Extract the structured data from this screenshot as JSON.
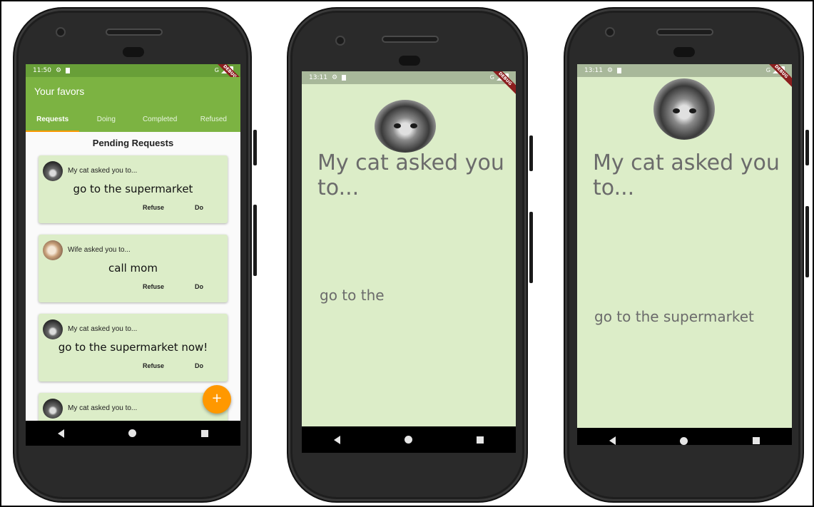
{
  "phones": [
    {
      "status": {
        "time": "11:50",
        "network": "G"
      },
      "debug_banner": "DEBUG",
      "appbar": {
        "title": "Your favors"
      },
      "tabs": [
        {
          "label": "Requests"
        },
        {
          "label": "Doing"
        },
        {
          "label": "Completed"
        },
        {
          "label": "Refused"
        }
      ],
      "section_title": "Pending Requests",
      "cards": [
        {
          "from": "My cat asked you to...",
          "what": "go to the supermarket",
          "refuse": "Refuse",
          "do": "Do"
        },
        {
          "from": "Wife asked you to...",
          "what": "call mom",
          "refuse": "Refuse",
          "do": "Do"
        },
        {
          "from": "My cat asked you to...",
          "what": "go to the supermarket now!",
          "refuse": "Refuse",
          "do": "Do"
        },
        {
          "from": "My cat asked you to..."
        }
      ],
      "fab": "+",
      "accent": "#7cb342",
      "fab_color": "#ff9800"
    },
    {
      "status": {
        "time": "13:11",
        "network": "G"
      },
      "debug_banner": "DEBUG",
      "from": "My cat asked you to...",
      "what": "go to the",
      "background": "#dcedc8"
    },
    {
      "status": {
        "time": "13:11",
        "network": "G"
      },
      "debug_banner": "DEBUG",
      "from": "My cat asked you to...",
      "what": "go to the supermarket",
      "background": "#dcedc8"
    }
  ]
}
